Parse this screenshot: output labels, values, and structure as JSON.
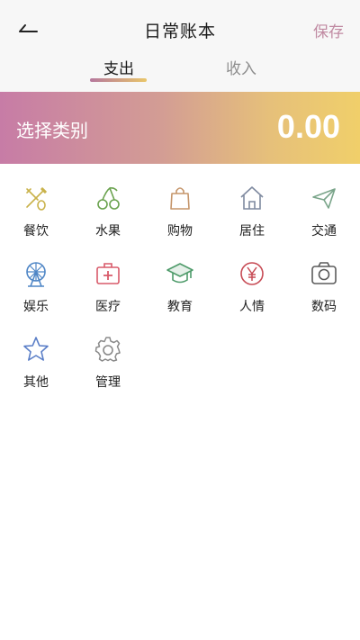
{
  "header": {
    "title": "日常账本",
    "save_label": "保存",
    "back_icon": "back-arrow-icon"
  },
  "tabs": [
    {
      "label": "支出",
      "active": true
    },
    {
      "label": "收入",
      "active": false
    }
  ],
  "banner": {
    "category_prompt": "选择类别",
    "amount": "0.00"
  },
  "categories": [
    {
      "label": "餐饮",
      "icon": "dining-icon",
      "color": "#c9b24a"
    },
    {
      "label": "水果",
      "icon": "cherry-icon",
      "color": "#6aa24e"
    },
    {
      "label": "购物",
      "icon": "shopping-bag-icon",
      "color": "#c5956a"
    },
    {
      "label": "居住",
      "icon": "house-icon",
      "color": "#7f8aa0"
    },
    {
      "label": "交通",
      "icon": "paper-plane-icon",
      "color": "#7aa58a"
    },
    {
      "label": "娱乐",
      "icon": "ferris-wheel-icon",
      "color": "#4f86c6"
    },
    {
      "label": "医疗",
      "icon": "medical-kit-icon",
      "color": "#d85a6a"
    },
    {
      "label": "教育",
      "icon": "graduation-cap-icon",
      "color": "#4e9b6a"
    },
    {
      "label": "人情",
      "icon": "money-coin-icon",
      "color": "#c74b55"
    },
    {
      "label": "数码",
      "icon": "camera-icon",
      "color": "#5b5b5b"
    },
    {
      "label": "其他",
      "icon": "star-icon",
      "color": "#5a7ec7"
    },
    {
      "label": "管理",
      "icon": "gear-icon",
      "color": "#8a8a8a"
    }
  ]
}
